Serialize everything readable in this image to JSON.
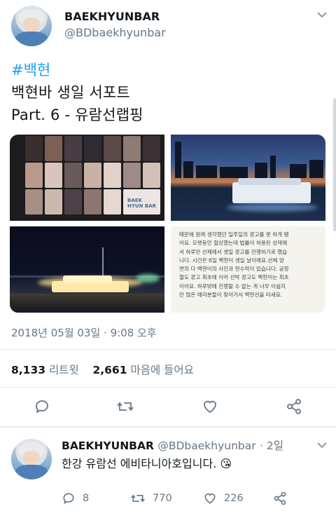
{
  "tweet": {
    "display_name": "BAEKHYUNBAR",
    "handle": "@BDbaekhyunbar",
    "hashtag": "#백현",
    "line1": "백현바 생일 서포트",
    "line2": "Part. 6 - 유람선랩핑",
    "timestamp": "2018년 05월 03일 · 9:08 오후",
    "retweets_count": "8,133",
    "retweets_label": "리트윗",
    "likes_count": "2,661",
    "likes_label": "마음에 들어요",
    "media": {
      "collage_caption": "BAEK HYUN BAR",
      "article_lines": [
        "때문에 원래 생각했던 일주일의 광고를 못 하게 됐",
        "어요. 오랫동안 협상했는데 법률이 허용된 상태에",
        "서 하루만 선체에서 생일 광고를 진행하기로 했습",
        "니다. 시간은 6일 백현이 생일 날이에요.선체 양",
        "면의 다 백현이의 사진과 현수막이 있습니다. 공항",
        "철도 광고 최초에 이어 선박 광고도 백현이는 최초",
        "이어요. 하루밖에 진행될 수 없는 게 너무 아쉽지",
        "만 많은 에리분들이 찾아가서 백현선을 타세요."
      ]
    }
  },
  "reply": {
    "display_name": "BAEKHYUNBAR",
    "handle": "@BDbaekhyunbar",
    "time": "· 2일",
    "text": "한강 유람선 에비타니아호입니다. 😘",
    "reply_count": "8",
    "retweet_count": "770",
    "like_count": "226"
  },
  "colors": {
    "link": "#1da1f2",
    "secondary": "#657786",
    "divider": "#e6ecf0",
    "primary_text": "#14171a"
  },
  "icons": [
    "chevron-down-icon",
    "reply-icon",
    "retweet-icon",
    "like-icon",
    "share-icon",
    "kiss-emoji"
  ]
}
